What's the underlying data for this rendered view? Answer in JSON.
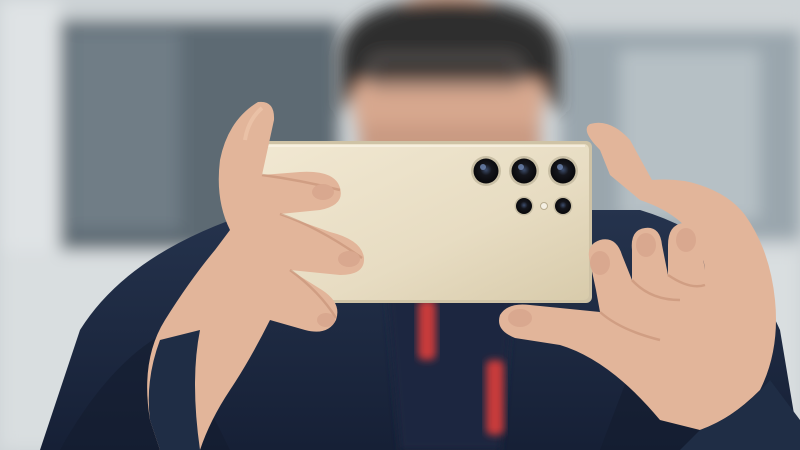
{
  "photo": {
    "palette": {
      "background": "#cdd3d6",
      "window_dark": "#556069",
      "window_light": "#e4e8ea",
      "skin": "#e2b59a",
      "skin_shadow": "#c58f74",
      "jacket": "#1f2d45",
      "jacket_dark": "#141d2e",
      "accent_red": "#c83a3a",
      "beanie": "#2f2d2e",
      "phone_body": "#e8dfc8",
      "phone_edge": "#cfc3a6",
      "lens": "#1b1c22"
    },
    "icons": {
      "camera_lenses": "lens-icon",
      "flash": "flash-icon"
    }
  }
}
